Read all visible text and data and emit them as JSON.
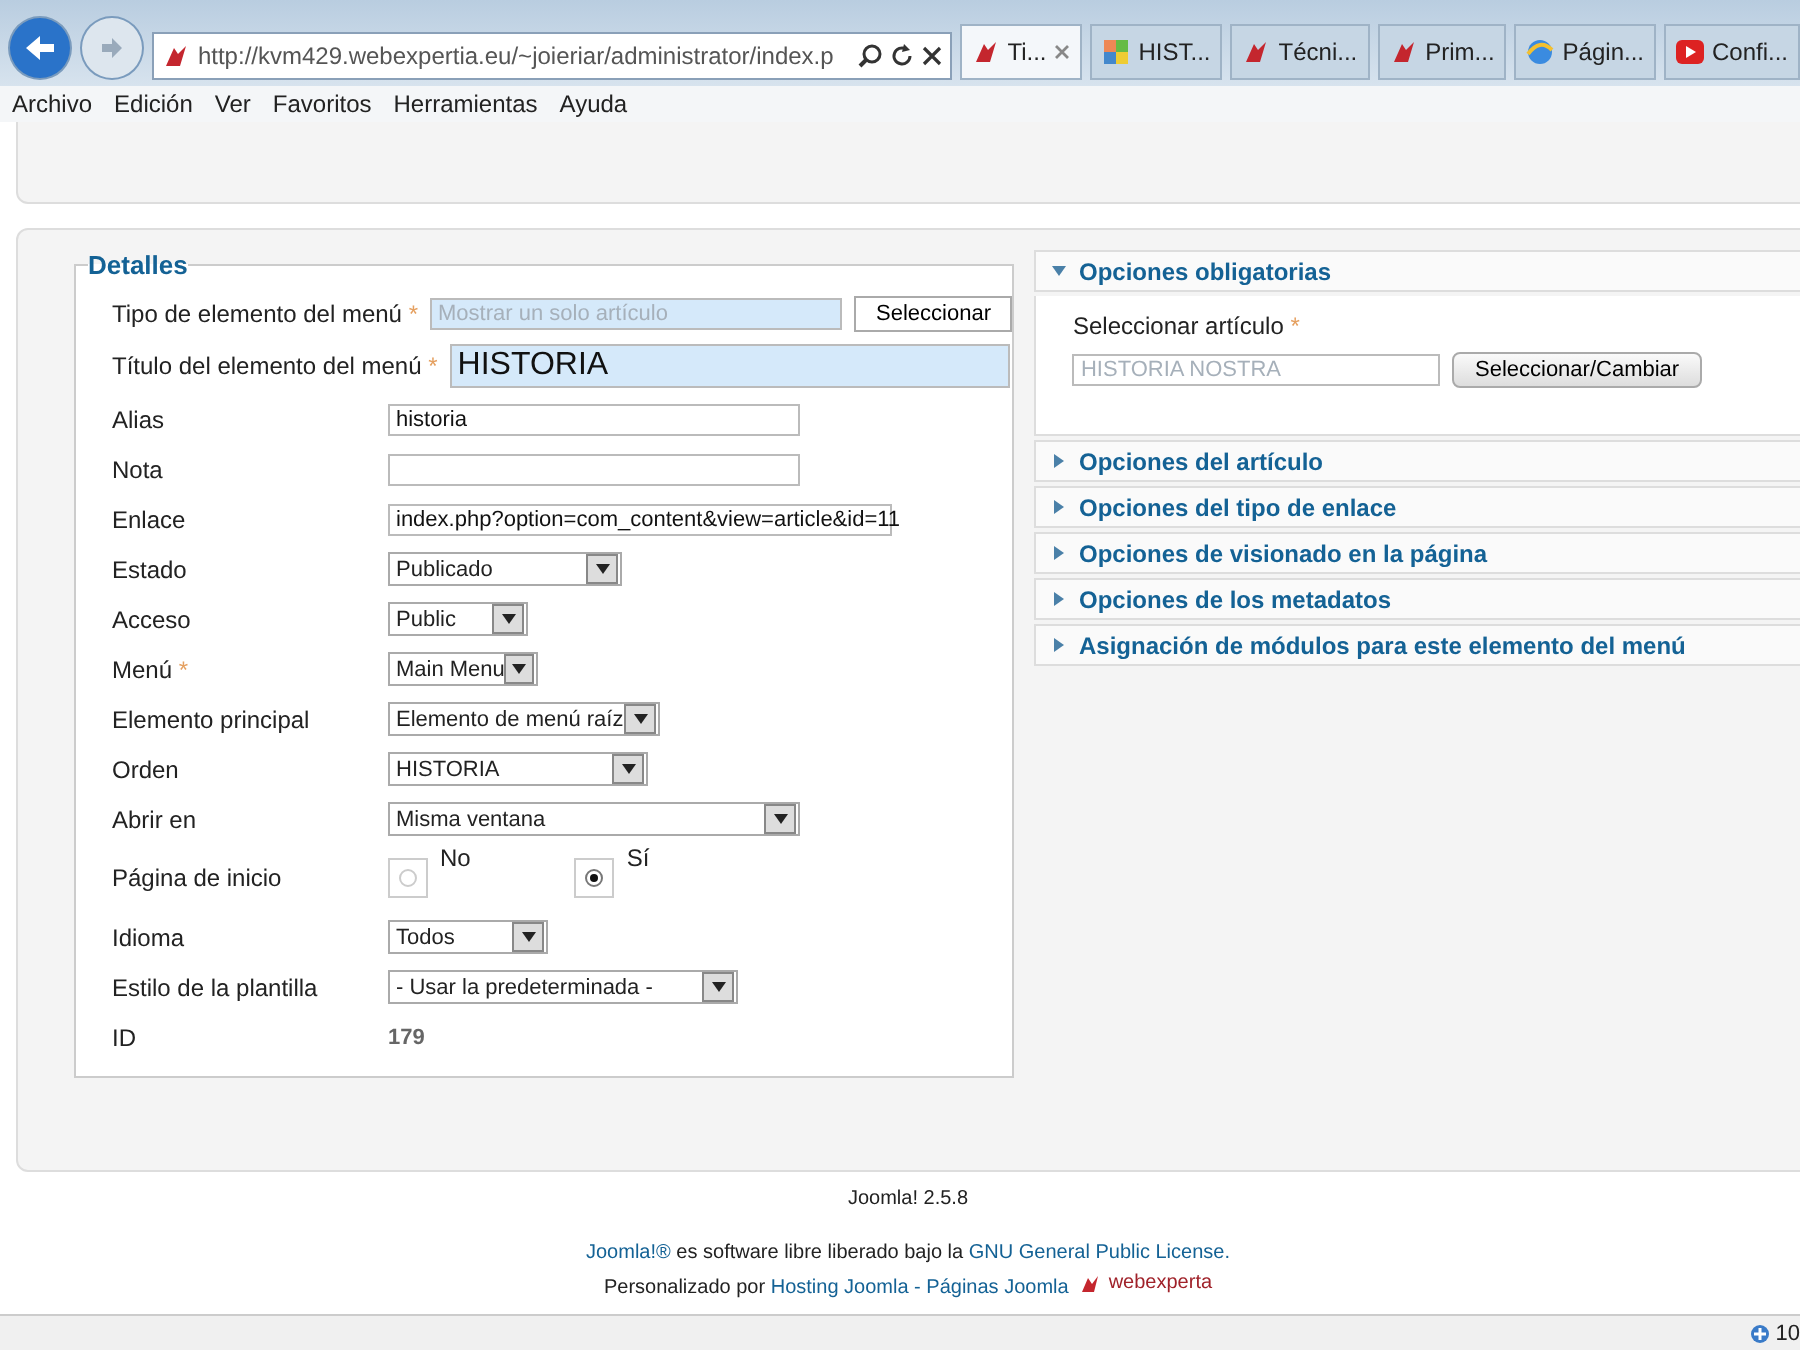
{
  "browser": {
    "address": "http://kvm429.webexpertia.eu/~joieriar/administrator/index.p",
    "tabs": [
      {
        "label": "Ti...",
        "selected": true,
        "kind": "joomla"
      },
      {
        "label": "HIST...",
        "selected": false,
        "kind": "puzzle"
      },
      {
        "label": "Técni...",
        "selected": false,
        "kind": "joomla"
      },
      {
        "label": "Prim...",
        "selected": false,
        "kind": "joomla"
      },
      {
        "label": "Págin...",
        "selected": false,
        "kind": "ie"
      },
      {
        "label": "Confi...",
        "selected": false,
        "kind": "video"
      }
    ],
    "menu": [
      "Archivo",
      "Edición",
      "Ver",
      "Favoritos",
      "Herramientas",
      "Ayuda"
    ]
  },
  "details": {
    "legend": "Detalles",
    "fields": [
      {
        "kind": "wide",
        "label": "Tipo de elemento del menú",
        "required": "*",
        "value": "Mostrar un solo artículo",
        "readonly": true,
        "button": "Seleccionar"
      },
      {
        "kind": "title",
        "label": "Título del elemento del menú",
        "required": "*",
        "value": "HISTORIA"
      },
      {
        "kind": "text",
        "label": "Alias",
        "value": "historia"
      },
      {
        "kind": "text",
        "label": "Nota"
      },
      {
        "kind": "link",
        "label": "Enlace",
        "value": "index.php?option=com_content&view=article&id=11"
      },
      {
        "kind": "select",
        "label": "Estado",
        "value": "Publicado"
      },
      {
        "kind": "select",
        "label": "Acceso",
        "value": "Public"
      },
      {
        "kind": "select",
        "label": "Menú",
        "required": "*",
        "value": "Main Menu"
      },
      {
        "kind": "select",
        "label": "Elemento principal",
        "value": "Elemento de menú raíz"
      },
      {
        "kind": "select",
        "label": "Orden",
        "value": "HISTORIA"
      },
      {
        "kind": "select",
        "label": "Abrir en",
        "value": "Misma ventana"
      },
      {
        "kind": "radio",
        "label": "Página de inicio",
        "options": [
          {
            "label": "No",
            "selected": false
          },
          {
            "label": "Sí",
            "selected": true
          }
        ]
      },
      {
        "kind": "select",
        "label": "Idioma",
        "value": "Todos"
      },
      {
        "kind": "select",
        "label": "Estilo de la plantilla",
        "value": "- Usar la predeterminada -"
      },
      {
        "kind": "static",
        "label": "ID",
        "value": "179"
      }
    ]
  },
  "options": [
    {
      "title": "Opciones obligatorias",
      "expanded": true,
      "field_label": "Seleccionar artículo",
      "required": "*",
      "readonly": true,
      "value": "HISTORIA NOSTRA",
      "button": "Seleccionar/Cambiar"
    },
    {
      "title": "Opciones del artículo",
      "expanded": false
    },
    {
      "title": "Opciones del tipo de enlace",
      "expanded": false
    },
    {
      "title": "Opciones de visionado en la página",
      "expanded": false
    },
    {
      "title": "Opciones de los metadatos",
      "expanded": false
    },
    {
      "title": "Asignación de módulos para este elemento del menú",
      "expanded": false
    }
  ],
  "footer": {
    "version": "Joomla! 2.5.8",
    "license_link": "Joomla!®",
    "license_text": "es software libre liberado bajo la",
    "license_name": "GNU General Public License.",
    "credit_text": "Personalizado por",
    "credit_link": "Hosting Joomla - Páginas Joomla",
    "logo": "webexperta"
  },
  "status_bar": {
    "zoom": "10"
  }
}
